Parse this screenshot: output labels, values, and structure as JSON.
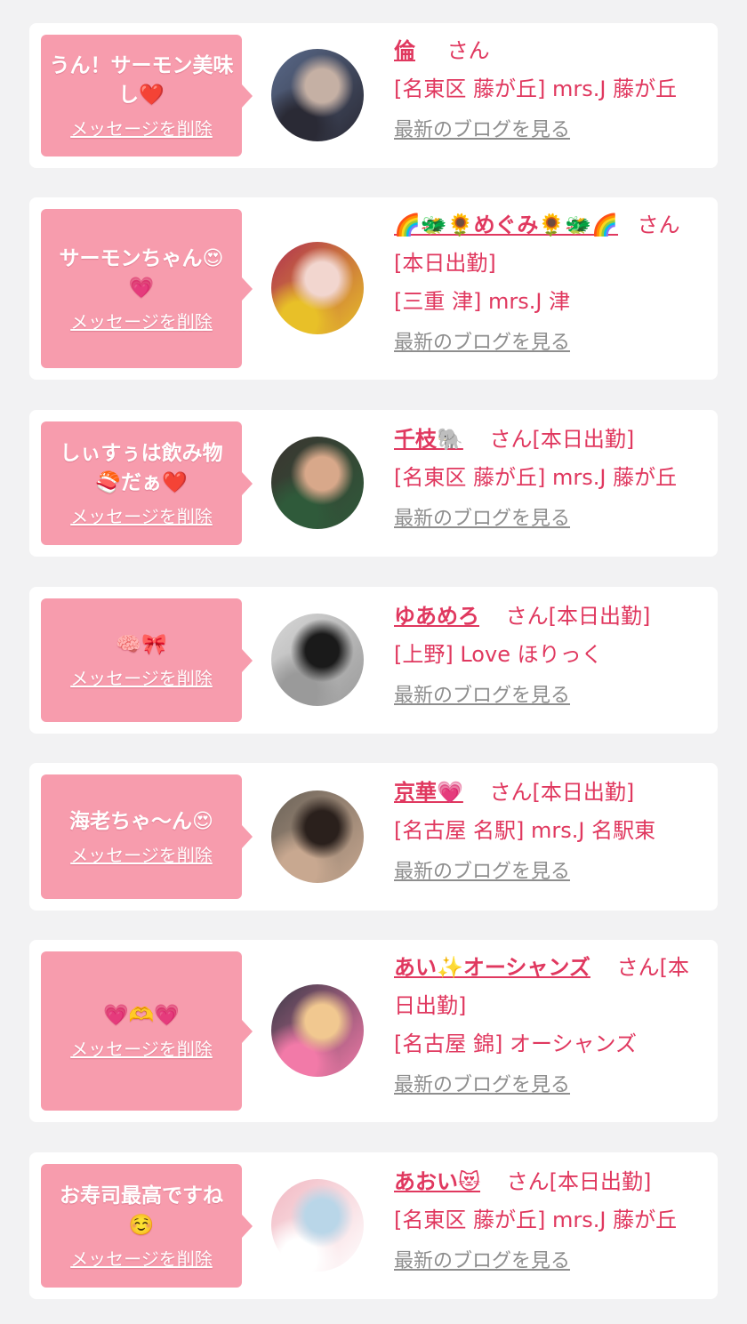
{
  "entries": [
    {
      "message": "うん！サーモン美味し❤️",
      "delete_label": "メッセージを削除",
      "name": "倫",
      "san_line": "さん",
      "shop": "[名東区 藤が丘] mrs.J 藤が丘",
      "blog_link": "最新のブログを見る",
      "avatar_colors": [
        "#5a6a8a",
        "#c5b0a4",
        "#2a2a35"
      ]
    },
    {
      "message": "サーモンちゃん😍💗",
      "delete_label": "メッセージを削除",
      "name": "🌈🐲🌻めぐみ🌻🐲🌈",
      "san_line": "さん[本日出勤]",
      "shop": "[三重 津] mrs.J 津",
      "blog_link": "最新のブログを見る",
      "avatar_colors": [
        "#b03050",
        "#f2d6cf",
        "#e8c028"
      ]
    },
    {
      "message": "しぃすぅは飲み物🍣だぁ❤️",
      "delete_label": "メッセージを削除",
      "name": "千枝🐘",
      "san_line": "さん[本日出勤]",
      "shop": "[名東区 藤が丘] mrs.J 藤が丘",
      "blog_link": "最新のブログを見る",
      "avatar_colors": [
        "#3a3430",
        "#d8a88a",
        "#2f5a3a"
      ]
    },
    {
      "message": "🧠🎀",
      "delete_label": "メッセージを削除",
      "name": "ゆあめろ",
      "san_line": "さん[本日出勤]",
      "shop": "[上野] Love ほりっく",
      "blog_link": "最新のブログを見る",
      "avatar_colors": [
        "#d8d8d8",
        "#1a1a1a",
        "#9a9a9a"
      ]
    },
    {
      "message": "海老ちゃ〜ん😍",
      "delete_label": "メッセージを削除",
      "name": "京華💗",
      "san_line": "さん[本日出勤]",
      "shop": "[名古屋 名駅] mrs.J 名駅東",
      "blog_link": "最新のブログを見る",
      "avatar_colors": [
        "#6a6258",
        "#2a201c",
        "#c8a890"
      ]
    },
    {
      "message": "💗🫶💗",
      "delete_label": "メッセージを削除",
      "name": "あい✨オーシャンズ",
      "san_line": "さん[本日出勤]",
      "shop": "[名古屋 錦] オーシャンズ",
      "blog_link": "最新のブログを見る",
      "avatar_colors": [
        "#3c3a48",
        "#f1c890",
        "#f27aa8"
      ]
    },
    {
      "message": "お寿司最高ですね☺️",
      "delete_label": "メッセージを削除",
      "name": "あおい😻",
      "san_line": "さん[本日出勤]",
      "shop": "[名東区 藤が丘] mrs.J 藤が丘",
      "blog_link": "最新のブログを見る",
      "avatar_colors": [
        "#f1b8c2",
        "#b9d6e8",
        "#ffffff"
      ]
    }
  ]
}
